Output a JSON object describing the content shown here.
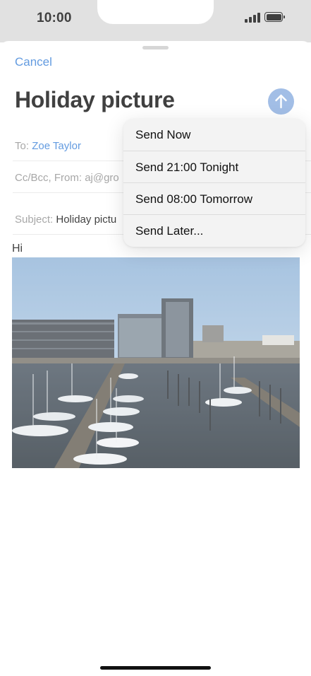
{
  "status_bar": {
    "time": "10:00"
  },
  "mail": {
    "cancel_label": "Cancel",
    "title": "Holiday picture",
    "to_label": "To:",
    "to_value": "Zoe Taylor",
    "cc_label": "Cc/Bcc, From:",
    "cc_value": "aj@gro",
    "subject_label": "Subject:",
    "subject_value": "Holiday pictu",
    "body_text": "Hi",
    "photo_icon": "harbor-photo"
  },
  "send_menu": {
    "items": [
      {
        "label": "Send Now"
      },
      {
        "label": "Send 21:00 Tonight"
      },
      {
        "label": "Send 08:00 Tomorrow"
      },
      {
        "label": "Send Later..."
      }
    ]
  },
  "colors": {
    "accent": "#2f7ad6",
    "send_button": "#83a8de",
    "status_bar_bg": "#d7d7d7"
  }
}
